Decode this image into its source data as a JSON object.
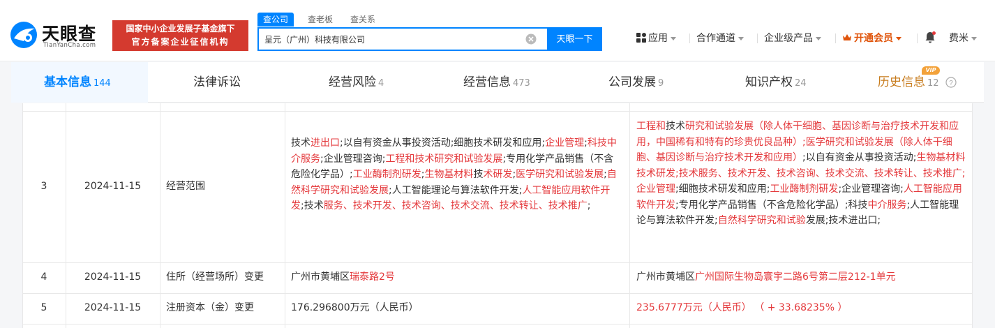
{
  "header": {
    "logo": {
      "cn": "天眼查",
      "en": "TianYanCha.com"
    },
    "slogan": {
      "line1": "国家中小企业发展子基金旗下",
      "line2": "官方备案企业征信机构"
    },
    "search": {
      "tabs": [
        "查公司",
        "查老板",
        "查关系"
      ],
      "query": "呈元（广州）科技有限公司",
      "button": "天眼一下"
    },
    "nav": {
      "apps": "应用",
      "channel": "合作通道",
      "enterprise": "企业级产品",
      "vip": "开通会员",
      "user": "费米"
    }
  },
  "tabs": [
    {
      "label": "基本信息",
      "count": "144"
    },
    {
      "label": "法律诉讼",
      "count": ""
    },
    {
      "label": "经营风险",
      "count": "4"
    },
    {
      "label": "经营信息",
      "count": "473"
    },
    {
      "label": "公司发展",
      "count": "9"
    },
    {
      "label": "知识产权",
      "count": "24"
    },
    {
      "label": "历史信息",
      "count": "12",
      "badge": "VIP"
    }
  ],
  "rows": [
    {
      "index": "3",
      "date": "2024-11-15",
      "item": "经营范围",
      "before": [
        {
          "t": "技术"
        },
        {
          "t": "进出口",
          "hl": true
        },
        {
          "t": ";以自有资金从事投资活动;细胞技术研发和应用;"
        },
        {
          "t": "企业管理",
          "hl": true
        },
        {
          "t": ";"
        },
        {
          "t": "科技中介服务",
          "hl": true
        },
        {
          "t": ";企业管理咨询;"
        },
        {
          "t": "工程和技术研究和试验发展",
          "hl": true
        },
        {
          "t": ";专用化学产品销售（不含危险化学品）;"
        },
        {
          "t": "工业酶制剂研发",
          "hl": true
        },
        {
          "t": ";"
        },
        {
          "t": "生物基材料",
          "hl": true
        },
        {
          "t": "技"
        },
        {
          "t": "术研发",
          "hl": true
        },
        {
          "t": ";"
        },
        {
          "t": "医学研究和试验发展",
          "hl": true
        },
        {
          "t": ";"
        },
        {
          "t": "自然科学研究和试验发展",
          "hl": true
        },
        {
          "t": ";人工智能理论与算法软件开发;"
        },
        {
          "t": "人工智能应用软件开发",
          "hl": true
        },
        {
          "t": ";技术"
        },
        {
          "t": "服务、技术开发、技术咨询、技术交流、技术转让、技术推广",
          "hl": true
        },
        {
          "t": ";"
        }
      ],
      "after": [
        {
          "t": "工程和",
          "hl": true
        },
        {
          "t": "技术"
        },
        {
          "t": "研究和试验发展（除人体干细胞、基因诊断与治疗技术开发和应用，中国稀有和特有的珍贵优良品种）;医学研究和试验发展（除人体干细胞、基因诊断与治疗技术开发和应用）",
          "hl": true
        },
        {
          "t": ";以自有资金从事投资活动;"
        },
        {
          "t": "生物基材料技术研发;技术服务、技术开发、技术咨询、技术交流、技术转让、技术推广;企业管理",
          "hl": true
        },
        {
          "t": ";细胞技术研发和应用;"
        },
        {
          "t": "工业酶制剂研发",
          "hl": true
        },
        {
          "t": ";企业管理咨询;"
        },
        {
          "t": "人工智能应用软件开发",
          "hl": true
        },
        {
          "t": ";专用化学产品销售（不含危险化学品）;科技"
        },
        {
          "t": "中介服务",
          "hl": true
        },
        {
          "t": ";人工智能理论与算法软件开发;"
        },
        {
          "t": "自然科学研究和试验",
          "hl": true
        },
        {
          "t": "发展;技术进出口;"
        }
      ]
    },
    {
      "index": "4",
      "date": "2024-11-15",
      "item": "住所（经营场所）变更",
      "before": [
        {
          "t": "广州市黄埔区"
        },
        {
          "t": "瑞泰路2号",
          "hl": true
        }
      ],
      "after": [
        {
          "t": "广州市黄埔区"
        },
        {
          "t": "广州国际生物岛寰宇二路6号第二层212-1单元",
          "hl": true
        }
      ]
    },
    {
      "index": "5",
      "date": "2024-11-15",
      "item": "注册资本（金）变更",
      "before": [
        {
          "t": "176.296800万元（人民币）"
        }
      ],
      "after": [
        {
          "t": "235.6777万元（人民币）",
          "hl": true
        },
        {
          "t": " （ + 33.68235% ）",
          "hl": true
        }
      ]
    }
  ]
}
